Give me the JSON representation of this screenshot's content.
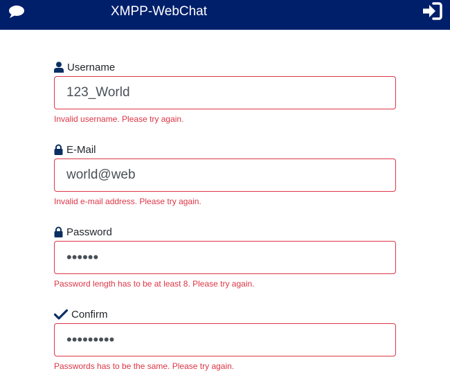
{
  "header": {
    "title": "XMPP-WebChat",
    "chat_icon": "chat-bubble-icon",
    "login_icon": "sign-in-icon"
  },
  "colors": {
    "navbar": "#001f6b",
    "error": "#dc3545",
    "icon": "#0b2f63"
  },
  "form": {
    "username": {
      "label": "Username",
      "icon": "user-icon",
      "value": "123_World",
      "error": "Invalid username. Please try again."
    },
    "email": {
      "label": "E-Mail",
      "icon": "lock-icon",
      "value": "world@web",
      "error": "Invalid e-mail address. Please try again."
    },
    "password": {
      "label": "Password",
      "icon": "lock-icon",
      "value": "••••••",
      "error": "Password length has to be at least 8. Please try again."
    },
    "confirm": {
      "label": "Confirm",
      "icon": "checkmark-icon",
      "value": "•••••••••",
      "error": "Passwords has to be the same. Please try again."
    }
  }
}
